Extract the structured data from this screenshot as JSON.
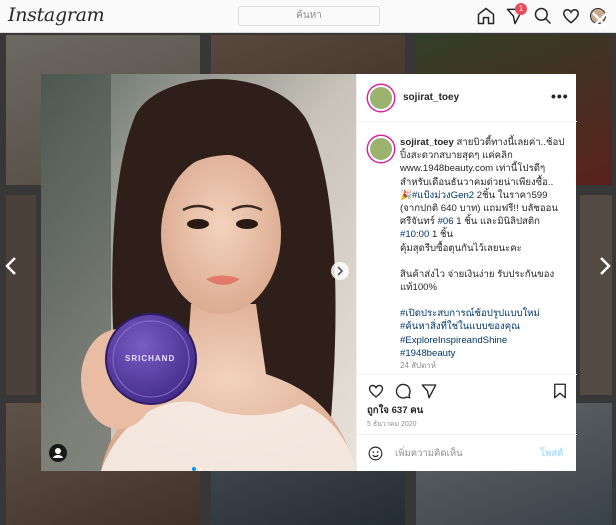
{
  "header": {
    "logo": "Instagram",
    "search_placeholder": "ค้นหา",
    "notification_count": "1",
    "icons": [
      "home-icon",
      "direct-icon",
      "explore-icon",
      "activity-icon",
      "profile-icon"
    ]
  },
  "post": {
    "username": "sojirat_toey",
    "more_label": "•••",
    "caption_user": "sojirat_toey",
    "caption_lines": [
      " สายบิวตี้ทางนี้เลยค่า..ช้อปปิ้งสะดวกสบายสุดๆ แค่คลิก www.1948beauty.com เท่านี้โปรดีๆสำหรับเดือนธันวาคมด่วยน่าเพียงซื้อ..",
      "🎉",
      "#แป้งม่วงGen2",
      " 2ชิ้น ในราคา599 (จากปกติ 640 บาท) แถมฟรี!! บลัชออนศรีจันทร์ ",
      "#06",
      " 1 ชิ้น และมินิลิปสติก ",
      "#10:00",
      " 1 ชิ้น",
      "คุ้มสุดรีบซื้อตุนกันไว้เลยนะคะ"
    ],
    "caption_p2": "สินค้าส่งไว จ่ายเงินง่าย รับประกันของแท้100%",
    "hashtags": [
      "#เปิดประสบการณ์ช้อปรูปแบบใหม่",
      "#ค้นหาสิ่งที่ใช่ในแบบของคุณ",
      "#ExploreInspireandShine",
      "#1948beauty"
    ],
    "caption_age": "24 สัปดาห์",
    "likes": "ถูกใจ 637 คน",
    "date": "5 ธันวาคม 2020",
    "comment_placeholder": "เพิ่มความคิดเห็น",
    "post_button": "โพสต์",
    "product_label": "SRICHAND"
  },
  "colors": {
    "accent": "#0095f6",
    "link": "#00376b",
    "product": "#5b3ea6"
  }
}
